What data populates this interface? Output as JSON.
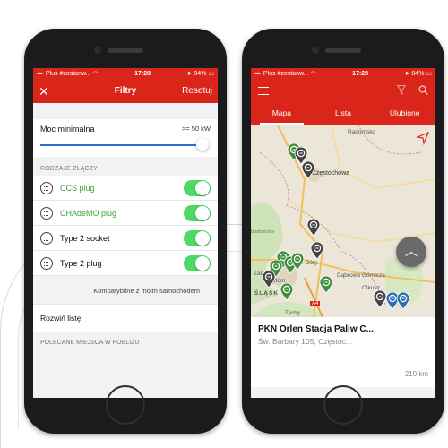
{
  "status_left": {
    "carrier": "Plus #zostanw...",
    "time": "17:28",
    "battery": "84%"
  },
  "status_right": {
    "carrier": "Plus #zostanw...",
    "time": "17:28",
    "battery": "84%"
  },
  "filters": {
    "title": "Filtry",
    "reset_label": "Resetuj",
    "min_power_label": "Moc minimalna",
    "min_power_value": ">= 50 kW",
    "slider_fraction": 1.0,
    "connectors_header": "RODZAJE ZŁĄCZY",
    "connectors": [
      {
        "label": "CCS plug",
        "enabled": true,
        "icon": "ccs-plug-icon"
      },
      {
        "label": "CHAdeMO plug",
        "enabled": true,
        "icon": "chademo-plug-icon"
      },
      {
        "label": "Type 2 socket",
        "enabled": true,
        "icon": "type2-socket-icon"
      },
      {
        "label": "Type 2 plug",
        "enabled": true,
        "icon": "type2-plug-icon"
      }
    ],
    "compatible_label": "Kompatybilne z moim samochodem",
    "expand_label": "Rozwiń listę",
    "nearby_header": "POLECANE MIEJSCA W POBLIŻU"
  },
  "map_screen": {
    "tabs": [
      "Mapa",
      "Lista",
      "Ulubione"
    ],
    "active_tab": 0,
    "map_labels": [
      "Radomsko",
      "Częstochowa",
      "Tarnowskie Góry",
      "Dąbrowa Górnicza",
      "Bytom",
      "Zab",
      "Olkusz",
      "Tychy",
      "A4",
      "ŚLĄSK",
      "bbobnickie"
    ],
    "station_name": "PKN Orlen Stacja Paliw C...",
    "station_address": "Św. Barbary 105, Częstoc...",
    "station_distance": "210 km"
  },
  "colors": {
    "brand_red": "#d9251a",
    "toggle_on": "#4cd964",
    "connector_green": "#3aa335",
    "slider_blue": "#2c6fd1"
  }
}
